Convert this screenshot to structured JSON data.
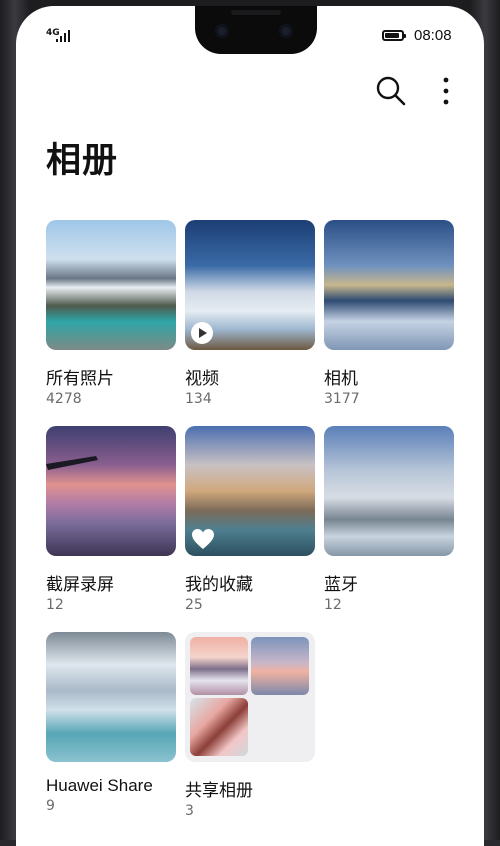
{
  "status_bar": {
    "network": "4G",
    "time": "08:08",
    "battery_percent": 90
  },
  "header": {
    "title": "相册",
    "search_icon": "search-icon",
    "more_icon": "more-vertical-icon"
  },
  "albums": [
    {
      "name": "所有照片",
      "count": "4278"
    },
    {
      "name": "视频",
      "count": "134",
      "overlay_icon": "play-icon"
    },
    {
      "name": "相机",
      "count": "3177"
    },
    {
      "name": "截屏录屏",
      "count": "12"
    },
    {
      "name": "我的收藏",
      "count": "25",
      "overlay_icon": "heart-icon"
    },
    {
      "name": "蓝牙",
      "count": "12"
    },
    {
      "name": "Huawei Share",
      "count": "9"
    },
    {
      "name": "共享相册",
      "count": "3"
    }
  ]
}
